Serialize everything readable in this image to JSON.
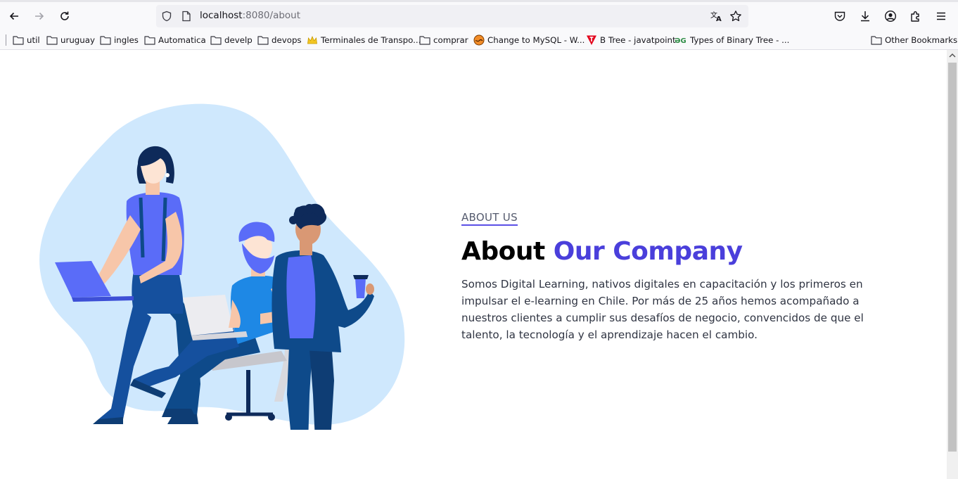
{
  "browser": {
    "url_host": "localhost",
    "url_rest": ":8080/about",
    "bookmarks": [
      {
        "label": "util",
        "icon": "folder-icon"
      },
      {
        "label": "uruguay",
        "icon": "folder-icon"
      },
      {
        "label": "ingles",
        "icon": "folder-icon"
      },
      {
        "label": "Automatica",
        "icon": "folder-icon"
      },
      {
        "label": "develp",
        "icon": "folder-icon"
      },
      {
        "label": "devops",
        "icon": "folder-icon"
      },
      {
        "label": "Terminales de Transpo...",
        "icon": "crown-favicon"
      },
      {
        "label": "comprar",
        "icon": "folder-icon"
      },
      {
        "label": "Change to MySQL - W...",
        "icon": "globe-favicon"
      },
      {
        "label": "B Tree - javatpoint",
        "icon": "javatpoint-favicon"
      },
      {
        "label": "Types of Binary Tree - ...",
        "icon": "gfg-favicon"
      }
    ],
    "other_bookmarks": "Other Bookmarks"
  },
  "about": {
    "kicker": "ABOUT US",
    "title_plain": "About ",
    "title_accent": "Our Company",
    "paragraph": "Somos Digital Learning, nativos digitales en capacitación y los primeros en impulsar el e-learning en Chile. Por más de 25 años hemos acompañado a nuestros clientes a cumplir sus desafíos de negocio, convencidos de que el talento, la tecnología y el aprendizaje hacen el cambio."
  },
  "colors": {
    "accent": "#4a3fdb",
    "blob": "#cfe8fd",
    "navy": "#0e4a8a",
    "blue": "#5a6cf8"
  }
}
